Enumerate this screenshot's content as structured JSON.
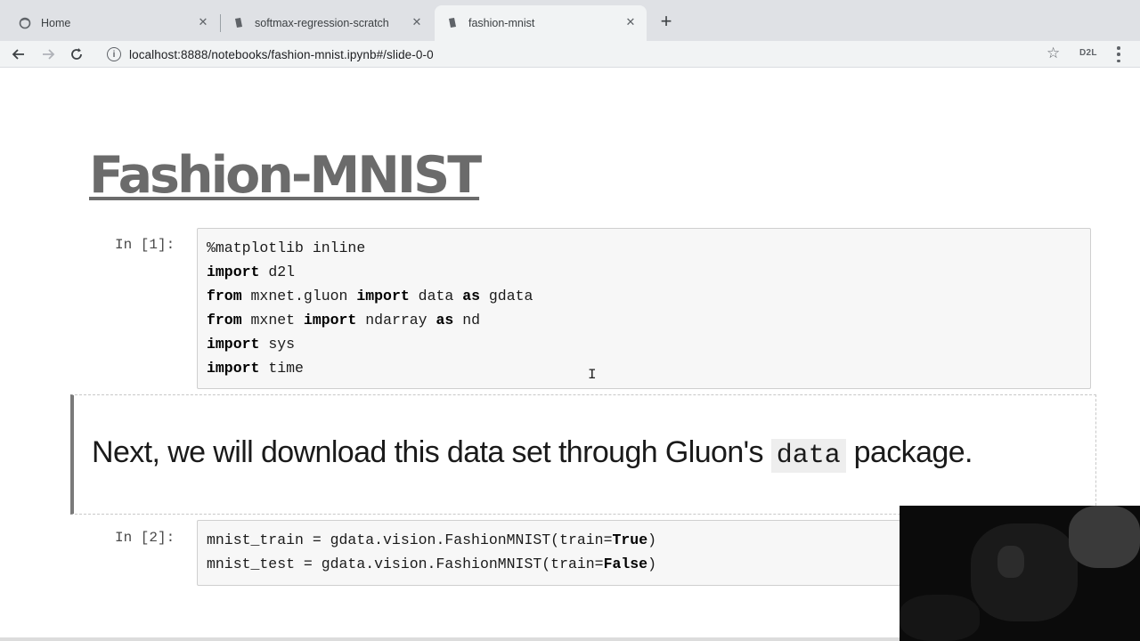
{
  "browser": {
    "tabs": [
      {
        "label": "Home",
        "icon": "jupyter-icon",
        "active": false
      },
      {
        "label": "softmax-regression-scratch",
        "icon": "notebook-icon",
        "active": false
      },
      {
        "label": "fashion-mnist",
        "icon": "notebook-icon",
        "active": true
      }
    ],
    "url": "localhost:8888/notebooks/fashion-mnist.ipynb#/slide-0-0",
    "extension_label": "D2L"
  },
  "notebook": {
    "title": "Fashion-MNIST",
    "cells": [
      {
        "prompt": "In [1]:",
        "lines": [
          [
            {
              "t": "%matplotlib inline",
              "b": false
            }
          ],
          [
            {
              "t": "import",
              "b": true
            },
            {
              "t": " d2l",
              "b": false
            }
          ],
          [
            {
              "t": "from",
              "b": true
            },
            {
              "t": " mxnet.gluon ",
              "b": false
            },
            {
              "t": "import",
              "b": true
            },
            {
              "t": " data ",
              "b": false
            },
            {
              "t": "as",
              "b": true
            },
            {
              "t": " gdata",
              "b": false
            }
          ],
          [
            {
              "t": "from",
              "b": true
            },
            {
              "t": " mxnet ",
              "b": false
            },
            {
              "t": "import",
              "b": true
            },
            {
              "t": " nd",
              "b": false
            },
            {
              "t": "array",
              "b": false
            },
            {
              "t": " ",
              "b": false
            },
            {
              "t": "as",
              "b": true
            },
            {
              "t": " nd",
              "b": false
            }
          ],
          [
            {
              "t": "import",
              "b": true
            },
            {
              "t": " sys",
              "b": false
            }
          ],
          [
            {
              "t": "import",
              "b": true
            },
            {
              "t": " time",
              "b": false
            }
          ]
        ]
      },
      {
        "prompt": "In [2]:",
        "lines": [
          [
            {
              "t": "mnist_train = gdata.vision.FashionMNIST(train=",
              "b": false
            },
            {
              "t": "True",
              "b": true
            },
            {
              "t": ")",
              "b": false
            }
          ],
          [
            {
              "t": "mnist_test = gdata.vision.FashionMNIST(train=",
              "b": false
            },
            {
              "t": "False",
              "b": true
            },
            {
              "t": ")",
              "b": false
            }
          ]
        ]
      }
    ],
    "markdown": {
      "before": "Next, we will download this data set through Gluon's ",
      "code": "data",
      "after": " package."
    }
  }
}
